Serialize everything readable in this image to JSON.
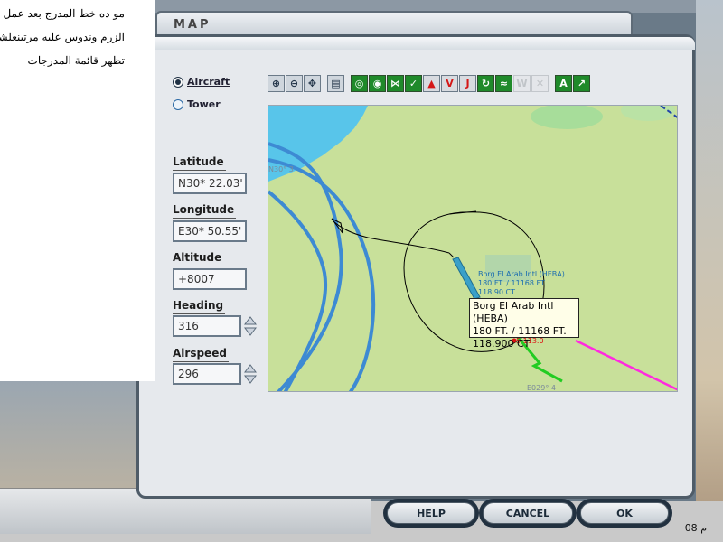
{
  "note": {
    "lines": [
      "مو ده خط المدرج بعد  عمل",
      "الزرم وندوس عليه مرتينعلشان",
      "تظهر قائمة المدرجات"
    ]
  },
  "window": {
    "title": "MAP",
    "view_options": {
      "aircraft_label": "Aircraft",
      "tower_label": "Tower",
      "selected": "Aircraft"
    },
    "fields": {
      "latitude": {
        "label": "Latitude",
        "value": "N30* 22.03'"
      },
      "longitude": {
        "label": "Longitude",
        "value": "E30* 50.55'"
      },
      "altitude": {
        "label": "Altitude",
        "value": "+8007"
      },
      "heading": {
        "label": "Heading",
        "value": "316"
      },
      "airspeed": {
        "label": "Airspeed",
        "value": "296"
      }
    },
    "toolbar": {
      "icons": [
        "zoom-in-icon",
        "zoom-out-icon",
        "center-icon",
        "print-icon",
        "vor-icon",
        "ndb-icon",
        "ils-icon",
        "intersection-icon",
        "airport-icon",
        "vor-label-icon",
        "jet-route-icon",
        "airway-icon",
        "victor-route-icon",
        "weather-icon",
        "label-icon",
        "terrain-icon"
      ]
    },
    "map": {
      "coord_label_top": "N30° 3",
      "coord_label_bottom": "E029° 4",
      "airport_label": "Borg El Arab Intl (HEBA)",
      "airport_label_2": "180  FT.  / 11168  FT.",
      "airport_label_3": "118.90 CT",
      "vor_label": "5  113.0",
      "tooltip": {
        "line1": "Borg El Arab Intl (HEBA)",
        "line2": "180  FT.  / 11168  FT.",
        "line3": "118.900 CT"
      }
    },
    "buttons": {
      "help": "HELP",
      "cancel": "CANCEL",
      "ok": "OK"
    }
  },
  "taskbar": {
    "clock_fragment": "08 م"
  }
}
